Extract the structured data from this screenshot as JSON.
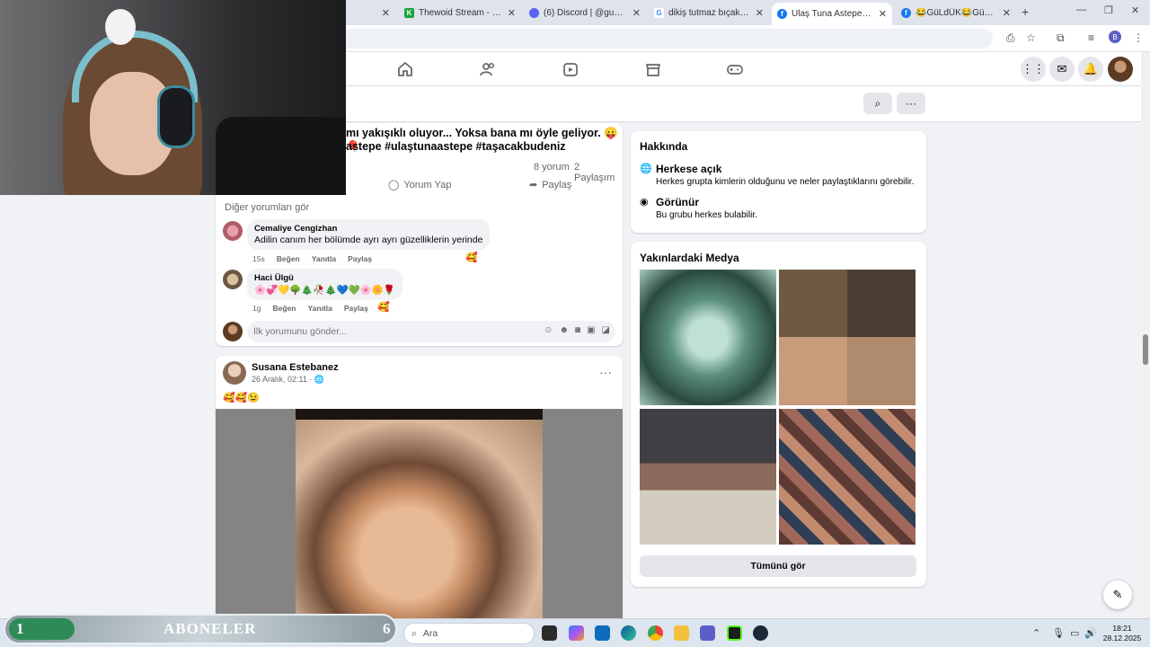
{
  "browser": {
    "tabs": [
      {
        "title": "",
        "favicon_color": "#9aa0a6"
      },
      {
        "title": "Thewoid Stream - Watch",
        "favicon_color": "#1aa33b"
      },
      {
        "title": "(6) Discord | @gumburtu",
        "favicon_color": "#5865f2"
      },
      {
        "title": "dikiş tutmaz bıçak - Goog",
        "favicon_color": "#4285f4"
      },
      {
        "title": "Ulaş Tuna Astepe💞 | Fac",
        "favicon_color": "#1877f2"
      },
      {
        "title": "😂GüLdÜK😂GüLdÜrDü",
        "favicon_color": "#1877f2"
      }
    ],
    "new_tab": "+",
    "profile_letter": "B"
  },
  "colors": {
    "fb_blue": "#1877f2",
    "fb_bg": "#f0f2f5",
    "subs_green": "#2e8b57"
  },
  "post1": {
    "text_line1": "mı yakışıklı oluyor... Yoksa bana mı öyle geliyor. 😛🎈",
    "text_line2": "astepe #ulaştunaastepe #taşacakbudeniz",
    "comments_count": "8 yorum",
    "shares_count": "2 Paylaşım",
    "comment_action": "Yorum Yap",
    "share_action": "Paylaş",
    "more_comments": "Diğer yorumları gör",
    "comments": [
      {
        "name": "Cemaliye Cengizhan",
        "text": "Adilin canım her bölümde ayrı ayrı güzelliklerin yerinde",
        "time": "15s",
        "like": "Beğen",
        "reply": "Yanıtla",
        "share": "Paylaş",
        "reaction": "🥰"
      },
      {
        "name": "Haci Ülgü",
        "text": "🌸💞💛🌳🎄🥀🎄💙💚🌸🌼🌹",
        "time": "1g",
        "like": "Beğen",
        "reply": "Yanıtla",
        "share": "Paylaş",
        "reaction": "🥰"
      }
    ],
    "compose_placeholder": "İlk yorumunu gönder..."
  },
  "post2": {
    "author": "Susana Estebanez",
    "date": "26 Aralık, 02:11 · 🌐",
    "emoji_text": "🥰🥰😉"
  },
  "about": {
    "title": "Hakkında",
    "rows": [
      {
        "icon": "globe-icon",
        "title": "Herkese açık",
        "desc": "Herkes grupta kimlerin olduğunu ve neler paylaştıklarını görebilir."
      },
      {
        "icon": "eye-icon",
        "title": "Görünür",
        "desc": "Bu grubu herkes bulabilir."
      }
    ]
  },
  "media": {
    "title": "Yakınlardaki Medya",
    "see_all": "Tümünü gör"
  },
  "subscribers": {
    "current": "1",
    "label": "ABONELER",
    "goal": "6",
    "progress_fraction": 0.17
  },
  "taskbar": {
    "search_placeholder": "Ara",
    "time": "18:21",
    "date": "28.12.2025"
  }
}
